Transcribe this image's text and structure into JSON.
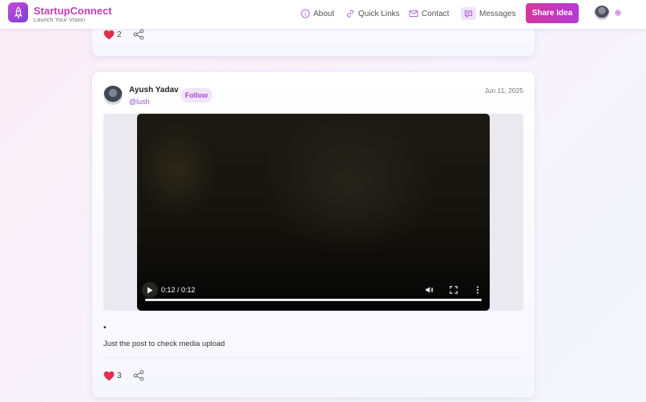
{
  "brand": {
    "name": "StartupConnect",
    "tagline": "Launch Your Vision"
  },
  "nav": {
    "about": "About",
    "quick_links": "Quick Links",
    "contact": "Contact",
    "messages": "Messages",
    "share_idea": "Share Idea"
  },
  "prev_post": {
    "likes": "2"
  },
  "post": {
    "author_name": "Ayush Yadav",
    "author_handle": "@lush",
    "follow_label": "Follow",
    "date": "Jun 11, 2025",
    "video_time": "0:12 / 0:12",
    "video_progress": 1.0,
    "bullet": "•",
    "text": "Just the post to check media upload",
    "likes": "3"
  },
  "icons": {
    "logo": "rocket-icon",
    "about": "info-icon",
    "quick_links": "link-icon",
    "contact": "mail-icon",
    "messages": "chat-icon",
    "settings": "gear-icon",
    "like": "heart-icon",
    "share": "share-icon"
  },
  "colors": {
    "brand": "#c03fb6",
    "accent": "#b43bd6",
    "heart": "#e0304e",
    "handle": "#9c4fd0"
  }
}
